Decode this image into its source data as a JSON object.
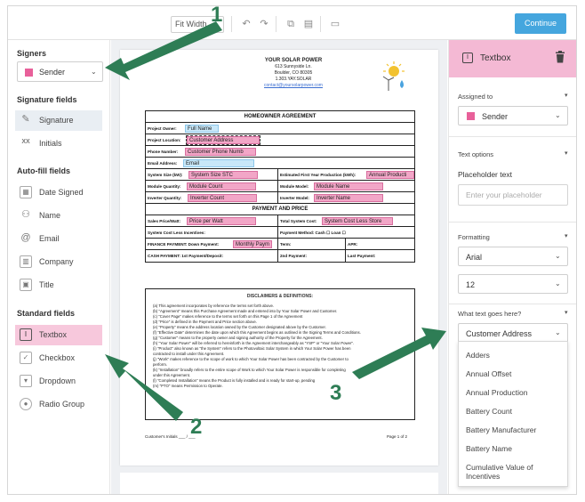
{
  "toolbar": {
    "zoom_value": "Fit Width",
    "continue_label": "Continue"
  },
  "left_sidebar": {
    "signers_title": "Signers",
    "signer_selected": "Sender",
    "signature_fields_title": "Signature fields",
    "signature_fields": [
      {
        "label": "Signature",
        "icon": "pen-icon"
      },
      {
        "label": "Initials",
        "icon": "initials-icon"
      }
    ],
    "auto_fill_title": "Auto-fill fields",
    "auto_fill_fields": [
      {
        "label": "Date Signed",
        "icon": "calendar-icon"
      },
      {
        "label": "Name",
        "icon": "person-icon"
      },
      {
        "label": "Email",
        "icon": "at-icon"
      },
      {
        "label": "Company",
        "icon": "building-icon"
      },
      {
        "label": "Title",
        "icon": "briefcase-icon"
      }
    ],
    "standard_title": "Standard fields",
    "standard_fields": [
      {
        "label": "Textbox",
        "icon": "textbox-icon"
      },
      {
        "label": "Checkbox",
        "icon": "checkbox-icon"
      },
      {
        "label": "Dropdown",
        "icon": "dropdown-icon"
      },
      {
        "label": "Radio Group",
        "icon": "radio-icon"
      }
    ]
  },
  "document": {
    "company_name": "YOUR SOLAR POWER",
    "address1": "613 Sunnyside Ln.",
    "address2": "Boulder, CO 80305",
    "phone": "1.303.YAY.SOLAR",
    "email": "contact@yoursolarpower.com",
    "agreement_title": "HOMEOWNER AGREEMENT",
    "rows": {
      "owner_label": "Project Owner:",
      "owner_field": "Full Name",
      "location_label": "Project Location:",
      "location_field": "Customer Address",
      "phone_label": "Phone Number:",
      "phone_field": "Customer Phone Numb",
      "email_label": "Email Address:",
      "email_field": "Email",
      "system_size_label": "System Size (kW):",
      "system_size_field": "System Size STC",
      "production_label": "Estimated First Year Production (kWh):",
      "production_field": "Annual Producti",
      "module_qty_label": "Module Quantity:",
      "module_qty_field": "Module Count",
      "module_model_label": "Module Model:",
      "module_model_field": "Module Name",
      "inverter_qty_label": "Inverter Quantity:",
      "inverter_qty_field": "Inverter Count",
      "inverter_model_label": "Inverter Model:",
      "inverter_model_field": "Inverter Name",
      "payment_title": "PAYMENT AND PRICE",
      "sales_price_label": "Sales Price/Watt:",
      "sales_price_field": "Price per Watt",
      "total_cost_label": "Total System Cost:",
      "total_cost_field": "System Cost Less Store",
      "less_incentives_label": "System Cost Less Incentives:",
      "payment_method_label": "Payment Method:  Cash ☐   Loan ☐",
      "finance_label": "FINANCE PAYMENT:   Down Payment:",
      "finance_field": "Monthly Paym",
      "term_label": "Term:",
      "apr_label": "APR:",
      "cash_label": "CASH PAYMENT:   1st Payment/Deposit:",
      "second_label": "2nd Payment:",
      "last_label": "Last Payment:"
    },
    "disclaimers_title": "DISCLAIMERS & DEFINITIONS:",
    "disclaimers": [
      "(a)  This agreement incorporates by reference the terms set forth above.",
      "(b)  \"Agreement\" means this Purchase Agreement made and entered into by Your Solar Power and Customer.",
      "(c)  \"Cover Page\" makes reference to the terms set forth on this Page 1 of the Agreement",
      "(d)  \"Price\" is defined in the Payment and Price section above.",
      "(e)  \"Property\" means the address location owned by the Customer designated above by the Customer.",
      "(f)  \"Effective Date\" determines the date upon which this Agreement begins as outlined in the Signing Terms and Conditions.",
      "(g)  \"Customer\" means to the property owner and signing authority of the Property for the Agreement.",
      "(h)  \"Your Solar Power\" will be referred to hereinforth in the Agreement interchangeably as \"YSP\" or \"Your Solar Power\".",
      "(i)  \"Product\" also known as \"the System\" refers to the Photovoltaic Solar System in which Your Solar Power has been",
      "contracted to install under this Agreement.",
      "(j)  \"Work\" makes reference to the scope of work to which Your Solar Power has been contracted by the Customer to",
      "perform.",
      "(k)  \"Installation\" broadly refers to the entire scope of Work to which Your Solar Power is responsible for completing",
      "under this Agreement.",
      "(l)  \"Completed Installation\" means the Product is fully installed and is ready for start-up, pending",
      "(m)  \"PTO\" means Permission to Operate."
    ],
    "initials_label": "Customer's Initials ___ / ___",
    "page_label": "Page 1 of 2"
  },
  "right_panel": {
    "title": "Textbox",
    "assigned_to_label": "Assigned to",
    "assigned_to_value": "Sender",
    "text_options_label": "Text options",
    "placeholder_label": "Placeholder text",
    "placeholder_hint": "Enter your placeholder",
    "formatting_label": "Formatting",
    "font_value": "Arial",
    "size_value": "12",
    "what_text_label": "What text goes here?",
    "what_text_value": "Customer Address",
    "options": [
      "Adders",
      "Annual Offset",
      "Annual Production",
      "Battery Count",
      "Battery Manufacturer",
      "Battery Name",
      "Cumulative Value of",
      "Incentives"
    ]
  },
  "callouts": {
    "one": "1",
    "two": "2",
    "three": "3"
  },
  "colors": {
    "accent_pink": "#f4b9d4",
    "field_pink": "#f2a6c7",
    "field_blue": "#c8e7f8",
    "continue_blue": "#45a6de",
    "callout_green": "#2e7d55"
  }
}
